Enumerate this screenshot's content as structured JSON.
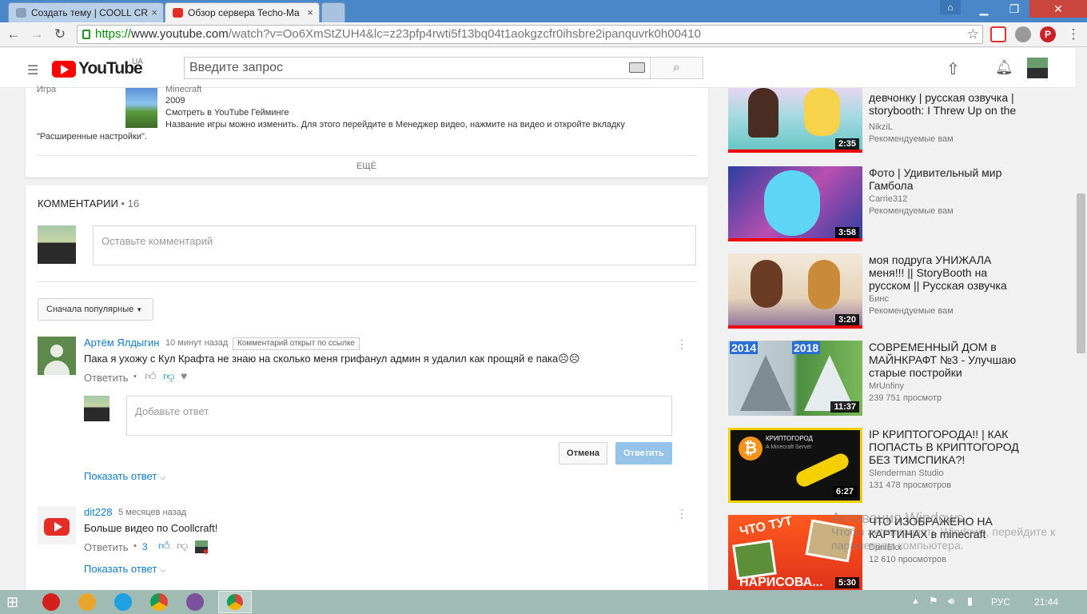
{
  "browser": {
    "tabs": [
      {
        "title": "Создать тему | COOLL CR"
      },
      {
        "title": "Обзор сервера Techo-Ma"
      }
    ],
    "url_scheme": "https://",
    "url_host": "www.youtube.com",
    "url_path": "/watch?v=Oo6XmStZUH4&lc=z23pfp4rwti5f13bq04t1aokgzcfr0ihsbre2ipanquvrk0h00410"
  },
  "youtube": {
    "logo_text": "YouTube",
    "region": "UA",
    "search_placeholder": "Введите запрос"
  },
  "description": {
    "meta_label": "Игра",
    "game_name": "Minecraft",
    "game_year": "2009",
    "gaming_link": "Смотреть в YouTube Гейминге",
    "note1": "Название игры можно изменить. Для этого перейдите в Менеджер видео, нажмите на видео и откройте вкладку",
    "note2": "\"Расширенные настройки\".",
    "more": "ЕЩЁ"
  },
  "comments": {
    "header": "КОММЕНТАРИИ",
    "count": "• 16",
    "input_placeholder": "Оставьте комментарий",
    "sort_label": "Сначала популярные",
    "items": [
      {
        "author": "Артём Ялдыгин",
        "time": "10 минут назад",
        "badge": "Комментарий открыт по ссылке",
        "text": "Пака я ухожу с Кул Крафта не знаю на сколько меня грифанул админ я удалил как прощяй е пака☹☹",
        "reply": "Ответить",
        "likes": ""
      },
      {
        "author": "dit228",
        "time": "5 месяцев назад",
        "text": "Больше видео по Coollcraft!",
        "reply": "Ответить",
        "likes": "3"
      }
    ],
    "reply_placeholder": "Добавьте ответ",
    "cancel": "Отмена",
    "submit": "Ответить",
    "show_reply": "Показать ответ"
  },
  "sidebar": [
    {
      "title1": "девчонку | русская озвучка |",
      "title2": "storybooth: I Threw Up on the",
      "title3": "",
      "channel": "NikziL",
      "meta": "Рекомендуемые вам",
      "duration": "2:35"
    },
    {
      "title1": "Фото | Удивительный мир",
      "title2": "Гамбола",
      "title3": "",
      "channel": "Carrie312",
      "meta": "Рекомендуемые вам",
      "duration": "3:58"
    },
    {
      "title1": "моя подруга УНИЖАЛА",
      "title2": "меня!!! || StoryBooth на",
      "title3": "русском || Русская озвучка",
      "channel": "Бинс",
      "meta": "Рекомендуемые вам",
      "duration": "3:20"
    },
    {
      "title1": "СОВРЕМЕННЫЙ ДОМ в",
      "title2": "МАЙНКРАФТ №3 - Улучшаю",
      "title3": "старые постройки",
      "channel": "MrUnfiny",
      "meta": "239 751 просмотр",
      "duration": "11:37",
      "tag1": "2014",
      "tag2": "2018"
    },
    {
      "title1": "IP КРИПТОГОРОДА!! | КАК",
      "title2": "ПОПАСТЬ В КРИПТОГОРОД",
      "title3": "БЕЗ ТИМСПИКА?!",
      "channel": "Slenderman Studio",
      "meta": "131 478 просмотров",
      "duration": "6:27",
      "tag1": "КРИПТОГОРОД",
      "tag2": "A Minecraft Server"
    },
    {
      "title1": "ЧТО ИЗОБРАЖЕНО НА",
      "title2": "КАРТИНАХ в minecraft",
      "title3": "",
      "channel": "DaniEkx",
      "meta": "12 610 просмотров",
      "duration": "5:30",
      "tag1": "ЧТО ТУТ",
      "tag2": "НАРИСОВА..."
    }
  ],
  "watermark": {
    "line1": "Активация Windows",
    "line2": "Чтобы активировать Windows, перейдите к",
    "line3": "параметрам компьютера."
  },
  "taskbar": {
    "lang": "РУС",
    "time": "21:44"
  },
  "colors": {
    "accent_blue": "#167ac6",
    "yt_red": "#ff0000",
    "taskbar": "#9fbbb3"
  }
}
